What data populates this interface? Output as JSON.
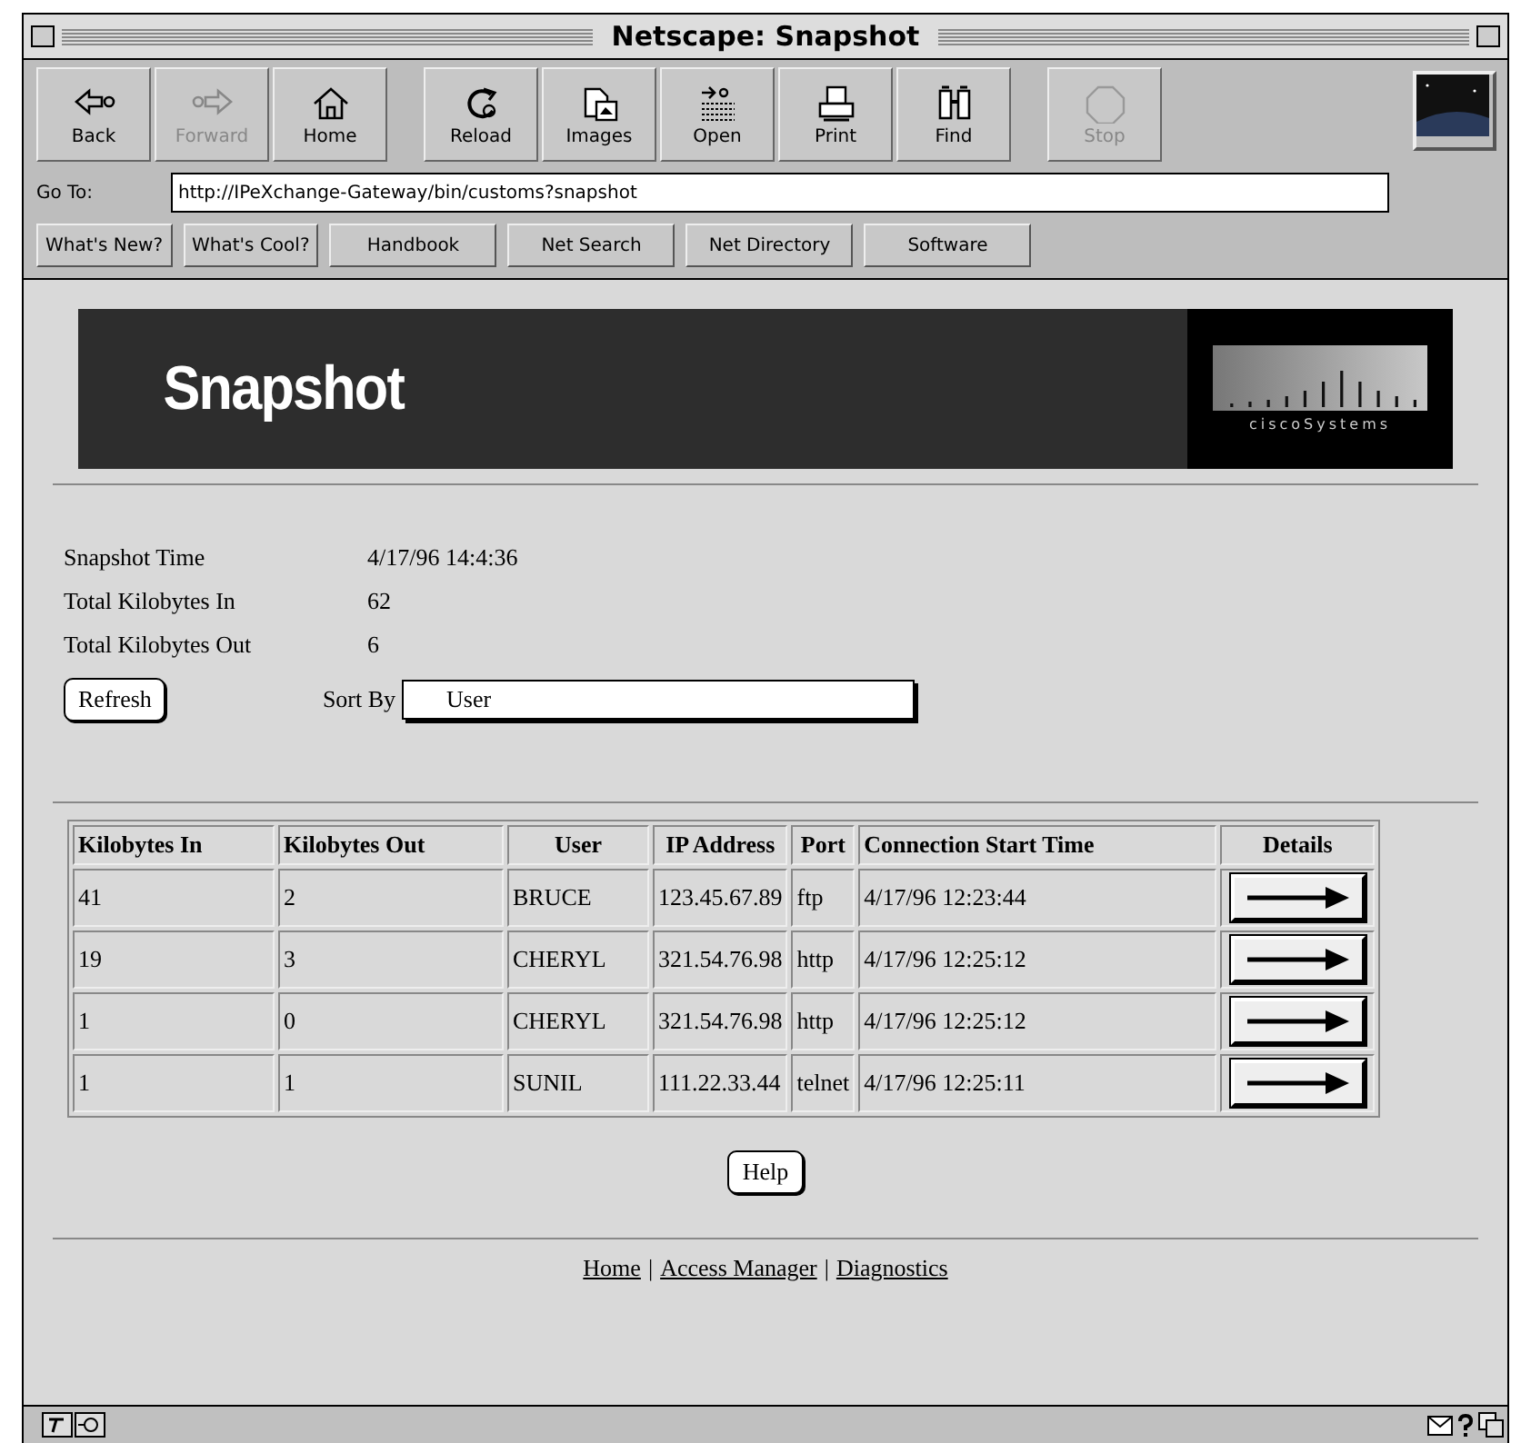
{
  "window": {
    "title": "Netscape: Snapshot"
  },
  "toolbar": [
    {
      "label": "Back",
      "kind": "back",
      "disabled": false
    },
    {
      "label": "Forward",
      "kind": "forward",
      "disabled": true
    },
    {
      "label": "Home",
      "kind": "home",
      "disabled": false
    },
    {
      "label": "Reload",
      "kind": "reload",
      "disabled": false,
      "group_start": true
    },
    {
      "label": "Images",
      "kind": "images",
      "disabled": false
    },
    {
      "label": "Open",
      "kind": "open",
      "disabled": false
    },
    {
      "label": "Print",
      "kind": "print",
      "disabled": false
    },
    {
      "label": "Find",
      "kind": "find",
      "disabled": false
    },
    {
      "label": "Stop",
      "kind": "stop",
      "disabled": true,
      "group_start": true
    }
  ],
  "location": {
    "label": "Go To:",
    "value": "http://IPeXchange-Gateway/bin/customs?snapshot"
  },
  "directory_buttons": [
    "What's New?",
    "What's Cool?",
    "Handbook",
    "Net Search",
    "Net Directory",
    "Software"
  ],
  "banner": {
    "title": "Snapshot",
    "logo_text": "ciscoSystems"
  },
  "summary": [
    {
      "label": "Snapshot Time",
      "value": "4/17/96 14:4:36"
    },
    {
      "label": "Total Kilobytes In",
      "value": "62"
    },
    {
      "label": "Total Kilobytes Out",
      "value": "6"
    }
  ],
  "refresh_button": "Refresh",
  "sort": {
    "label": "Sort By",
    "value": "User"
  },
  "table": {
    "columns": [
      "Kilobytes In",
      "Kilobytes Out",
      "User",
      "IP Address",
      "Port",
      "Connection Start Time",
      "Details"
    ],
    "rows": [
      [
        "41",
        "2",
        "BRUCE",
        "123.45.67.89",
        "ftp",
        "4/17/96 12:23:44"
      ],
      [
        "19",
        "3",
        "CHERYL",
        "321.54.76.98",
        "http",
        "4/17/96 12:25:12"
      ],
      [
        "1",
        "0",
        "CHERYL",
        "321.54.76.98",
        "http",
        "4/17/96 12:25:12"
      ],
      [
        "1",
        "1",
        "SUNIL",
        "111.22.33.44",
        "telnet",
        "4/17/96 12:25:11"
      ]
    ]
  },
  "help_button": "Help",
  "footer_links": [
    "Home",
    "Access Manager",
    "Diagnostics"
  ],
  "footer_separator": "|"
}
